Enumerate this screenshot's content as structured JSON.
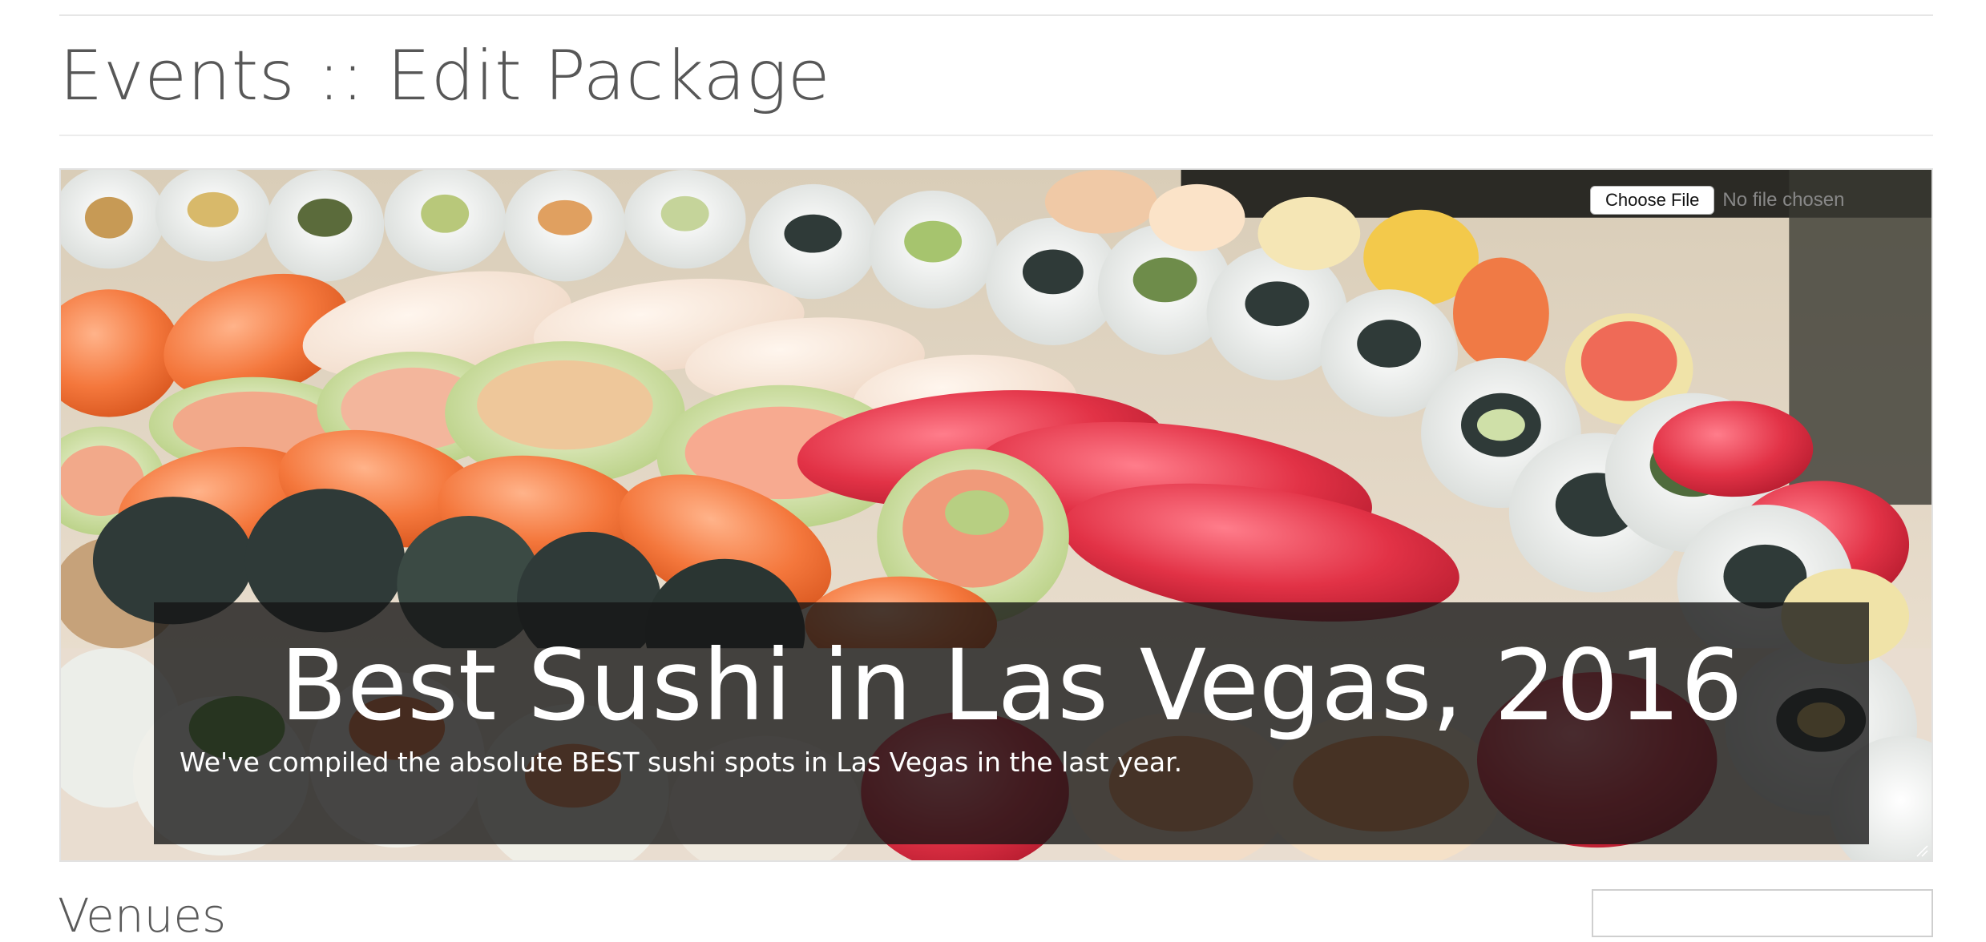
{
  "page": {
    "title": "Events :: Edit Package"
  },
  "hero": {
    "image_description": "sushi-platter-photo",
    "file_button_label": "Choose File",
    "file_status": "No file chosen",
    "title": "Best Sushi in Las Vegas, 2016",
    "description": "We've compiled the absolute BEST sushi spots in Las Vegas in the last year."
  },
  "venues": {
    "heading": "Venues",
    "search_value": "",
    "search_placeholder": ""
  },
  "colors": {
    "title_text": "#575757",
    "caption_overlay": "#141414",
    "salmon": "#f07a45",
    "tuna": "#e0334a",
    "roll_rice": "#eef0ee",
    "nori": "#2f3a38",
    "cucumber": "#cfe0a8"
  }
}
